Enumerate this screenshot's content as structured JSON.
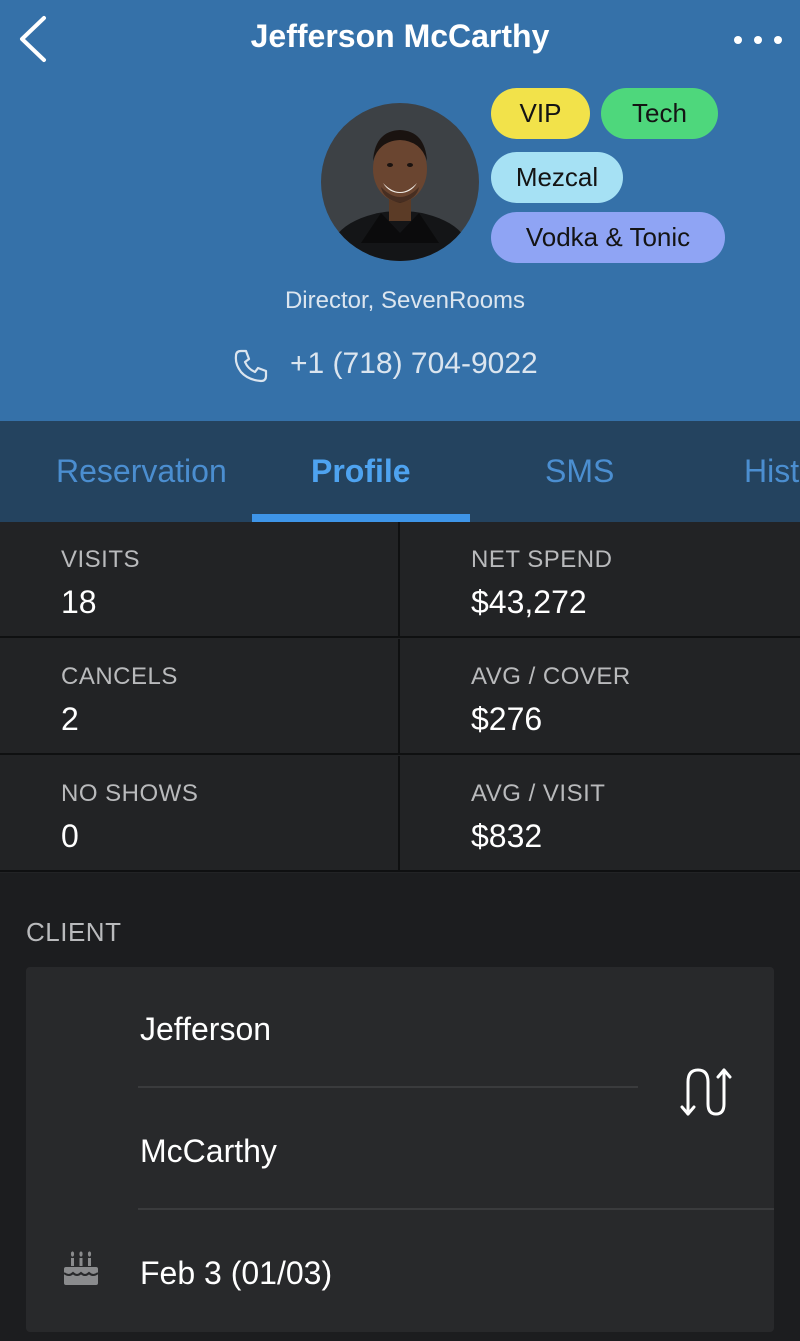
{
  "header": {
    "title": "Jefferson McCarthy",
    "back_icon": "chevron-left-icon",
    "more_icon": "more-horizontal-icon",
    "job": "Director, SevenRooms",
    "phone": "+1 (718) 704-9022",
    "tags": [
      {
        "label": "VIP",
        "color": "#f2e24a"
      },
      {
        "label": "Tech",
        "color": "#4ed77c"
      },
      {
        "label": "Mezcal",
        "color": "#a6e1f4"
      },
      {
        "label": "Vodka & Tonic",
        "color": "#8fa4f4"
      }
    ],
    "background": "#3571a9"
  },
  "tabs": {
    "items": [
      {
        "label": "Reservation"
      },
      {
        "label": "Profile",
        "active": true
      },
      {
        "label": "SMS"
      },
      {
        "label": "Hist"
      }
    ],
    "active_color": "#4ea3f0"
  },
  "stats": [
    {
      "label": "VISITS",
      "value": "18"
    },
    {
      "label": "NET SPEND",
      "value": "$43,272"
    },
    {
      "label": "CANCELS",
      "value": "2"
    },
    {
      "label": "AVG / COVER",
      "value": "$276"
    },
    {
      "label": "NO SHOWS",
      "value": "0"
    },
    {
      "label": "AVG / VISIT",
      "value": "$832"
    }
  ],
  "client": {
    "heading": "CLIENT",
    "first_name": "Jefferson",
    "last_name": "McCarthy",
    "birthday": "Feb 3 (01/03)",
    "swap_icon": "swap-names-icon",
    "birthday_icon": "birthday-cake-icon"
  }
}
